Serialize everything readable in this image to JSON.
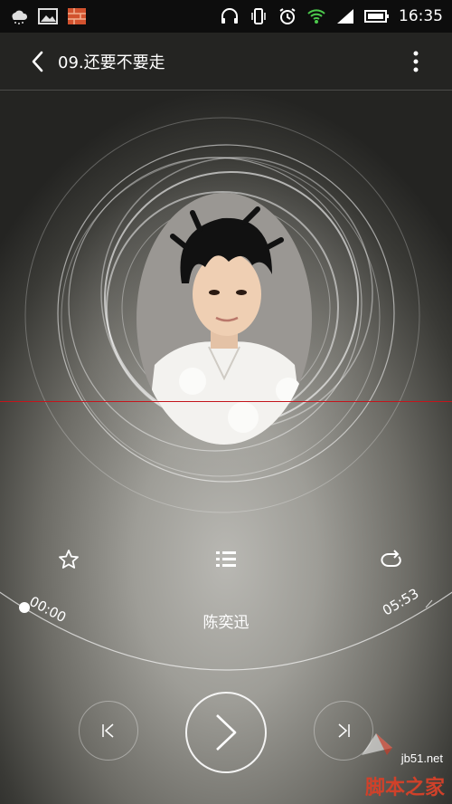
{
  "status_bar": {
    "time": "16:35",
    "left_icons": [
      "weather-icon",
      "image-icon",
      "app-icon"
    ],
    "right_icons": [
      "headset-icon",
      "vibrate-icon",
      "alarm-icon",
      "wifi-icon",
      "signal-icon",
      "battery-icon"
    ]
  },
  "header": {
    "title": "09.还要不要走"
  },
  "player": {
    "artist": "陈奕迅",
    "elapsed": "00:00",
    "duration": "05:53",
    "progress": 0
  },
  "watermark": {
    "url": "jb51.net",
    "text": "脚本之家"
  },
  "colors": {
    "accent_line": "#c4151c",
    "watermark_text": "#d0412a"
  }
}
